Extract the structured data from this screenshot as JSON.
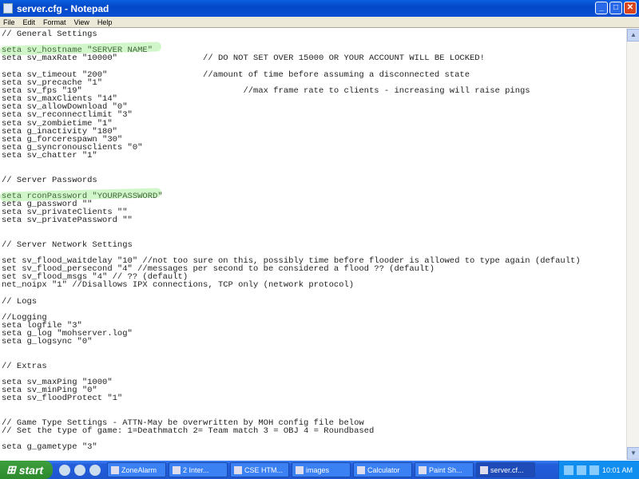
{
  "window": {
    "title": "server.cfg - Notepad"
  },
  "menu": [
    "File",
    "Edit",
    "Format",
    "View",
    "Help"
  ],
  "lines": [
    "// General Settings",
    "",
    "seta sv_hostname \"SERVER NAME\"",
    "seta sv_maxRate \"10000\"                 // DO NOT SET OVER 15000 OR YOUR ACCOUNT WILL BE LOCKED!",
    "",
    "seta sv_timeout \"200\"                   //amount of time before assuming a disconnected state",
    "seta sv_precache \"1\"",
    "seta sv_fps \"19\"                                //max frame rate to clients - increasing will raise pings",
    "seta sv_maxClients \"14\"",
    "seta sv_allowDownload \"0\"",
    "seta sv_reconnectlimit \"3\"",
    "seta sv_zombietime \"1\"",
    "seta g_inactivity \"180\"",
    "seta g_forcerespawn \"30\"",
    "seta g_syncronousclients \"0\"",
    "seta sv_chatter \"1\"",
    "",
    "",
    "// Server Passwords",
    "",
    "seta rconPassword \"YOURPASSWORD\"",
    "seta g_password \"\"",
    "seta sv_privateClients \"\"",
    "seta sv_privatePassword \"\"",
    "",
    "",
    "// Server Network Settings",
    "",
    "set sv_flood_waitdelay \"10\" //not too sure on this, possibly time before flooder is allowed to type again (default)",
    "set sv_flood_persecond \"4\" //messages per second to be considered a flood ?? (default)",
    "set sv_flood_msgs \"4\" // ?? (default)",
    "net_noipx \"1\" //Disallows IPX connections, TCP only (network protocol)",
    "",
    "// Logs",
    "",
    "//Logging",
    "seta logfile \"3\"",
    "seta g_log \"mohserver.log\"",
    "seta g_logsync \"0\"",
    "",
    "",
    "// Extras",
    "",
    "seta sv_maxPing \"1000\"",
    "seta sv_minPing \"0\"",
    "seta sv_floodProtect \"1\"",
    "",
    "",
    "// Game Type Settings - ATTN-May be overwritten by MOH config file below",
    "// Set the type of game: 1=Deathmatch 2= Team match 3 = OBJ 4 = Roundbased",
    "",
    "seta g_gametype \"3\""
  ],
  "highlighted_lines": [
    2,
    20
  ],
  "taskbar": {
    "start": "start",
    "tasks": [
      "ZoneAlarm",
      "2 Inter...",
      "CSE HTM...",
      "images",
      "Calculator",
      "Paint Sh...",
      "server.cf..."
    ],
    "active": 6,
    "clock": "10:01 AM"
  }
}
